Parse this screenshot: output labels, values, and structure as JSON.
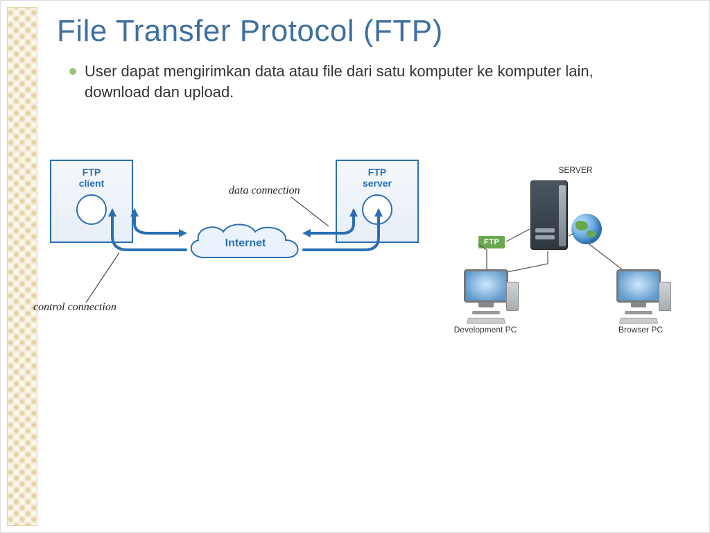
{
  "title": "File Transfer Protocol (FTP)",
  "bullets": [
    "User dapat mengirimkan data atau file dari satu komputer ke komputer lain, download dan upload."
  ],
  "diagram1": {
    "client_label_1": "FTP",
    "client_label_2": "client",
    "server_label_1": "FTP",
    "server_label_2": "server",
    "cloud_label": "Internet",
    "data_connection_label": "data connection",
    "control_connection_label": "control connection"
  },
  "diagram2": {
    "server_label": "SERVER",
    "ftp_badge": "FTP",
    "dev_pc_label": "Development PC",
    "browser_pc_label": "Browser PC"
  }
}
